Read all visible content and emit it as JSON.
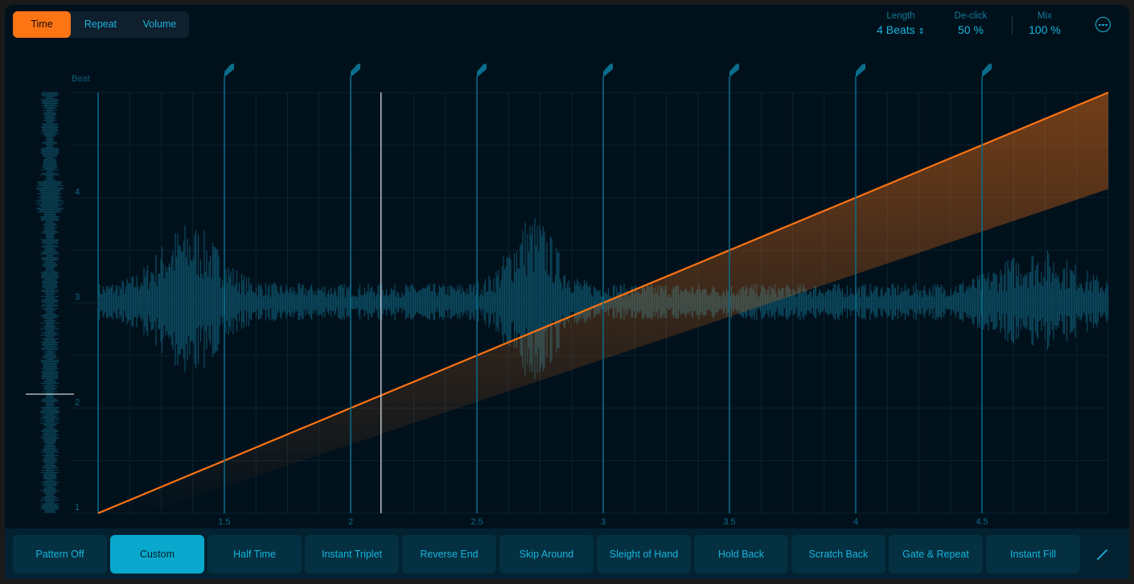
{
  "tabs": [
    {
      "label": "Time",
      "active": true
    },
    {
      "label": "Repeat",
      "active": false
    },
    {
      "label": "Volume",
      "active": false
    }
  ],
  "params": {
    "length": {
      "label": "Length",
      "value": "4 Beats",
      "icon": "up-down-chevron-icon"
    },
    "declick": {
      "label": "De-click",
      "value": "50 %"
    },
    "mix": {
      "label": "Mix",
      "value": "100 %"
    }
  },
  "more_icon": "ellipsis-circle-icon",
  "plot": {
    "y_title": "Beat",
    "y_ticks": [
      "1",
      "2",
      "3",
      "4"
    ],
    "x_ticks": [
      "1.5",
      "2",
      "2.5",
      "3",
      "3.5",
      "4",
      "4.5"
    ],
    "x_range": [
      1,
      5
    ],
    "y_range": [
      1,
      5
    ],
    "curve": [
      [
        1,
        1
      ],
      [
        5,
        5
      ]
    ],
    "markers": [
      1.5,
      2,
      2.5,
      3,
      3.5,
      4,
      4.5
    ],
    "playhead": 2.12,
    "colors": {
      "curve": "#fc7414",
      "marker": "#0a6e8c",
      "waveform": "#0c4a60"
    }
  },
  "patterns": [
    {
      "label": "Pattern Off",
      "active": false
    },
    {
      "label": "Custom",
      "active": true
    },
    {
      "label": "Half Time",
      "active": false
    },
    {
      "label": "Instant Triplet",
      "active": false
    },
    {
      "label": "Reverse End",
      "active": false
    },
    {
      "label": "Skip Around",
      "active": false
    },
    {
      "label": "Sleight of Hand",
      "active": false
    },
    {
      "label": "Hold Back",
      "active": false
    },
    {
      "label": "Scratch Back",
      "active": false
    },
    {
      "label": "Gate & Repeat",
      "active": false
    },
    {
      "label": "Instant Fill",
      "active": false
    }
  ],
  "edit_icon": "pencil-icon"
}
